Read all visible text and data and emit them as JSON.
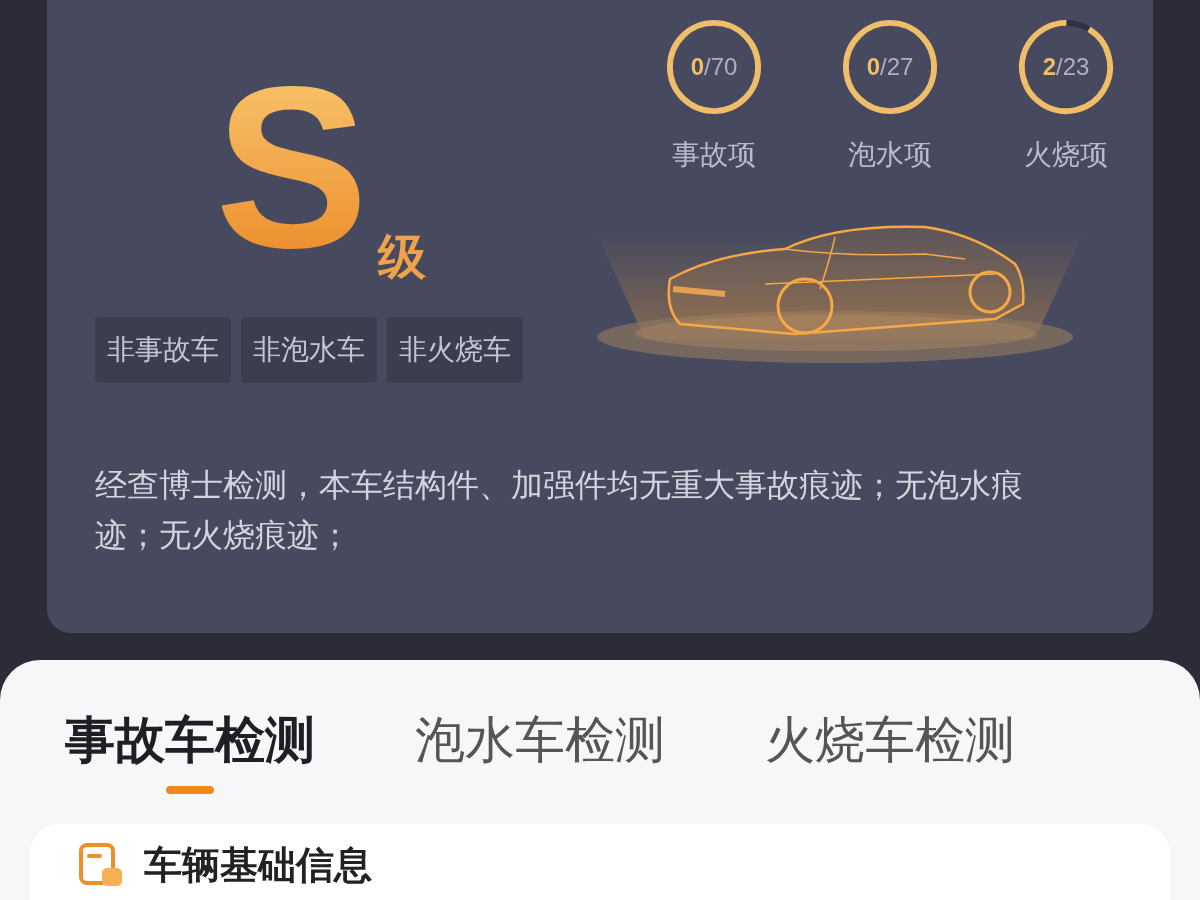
{
  "report": {
    "grade": "S",
    "grade_suffix": "级",
    "checks": [
      {
        "count": "0",
        "total": "/70",
        "label": "事故项",
        "level": 1
      },
      {
        "count": "0",
        "total": "/27",
        "label": "泡水项",
        "level": 1
      },
      {
        "count": "2",
        "total": "/23",
        "label": "火烧项",
        "level": 0.913
      }
    ],
    "tags": [
      "非事故车",
      "非泡水车",
      "非火烧车"
    ],
    "summary": "经查博士检测，本车结构件、加强件均无重大事故痕迹；无泡水痕迹；无火烧痕迹；"
  },
  "tabs": [
    {
      "label": "事故车检测",
      "selected": true
    },
    {
      "label": "泡水车检测",
      "selected": false
    },
    {
      "label": "火烧车检测",
      "selected": false
    }
  ],
  "section": {
    "title": "车辆基础信息"
  }
}
